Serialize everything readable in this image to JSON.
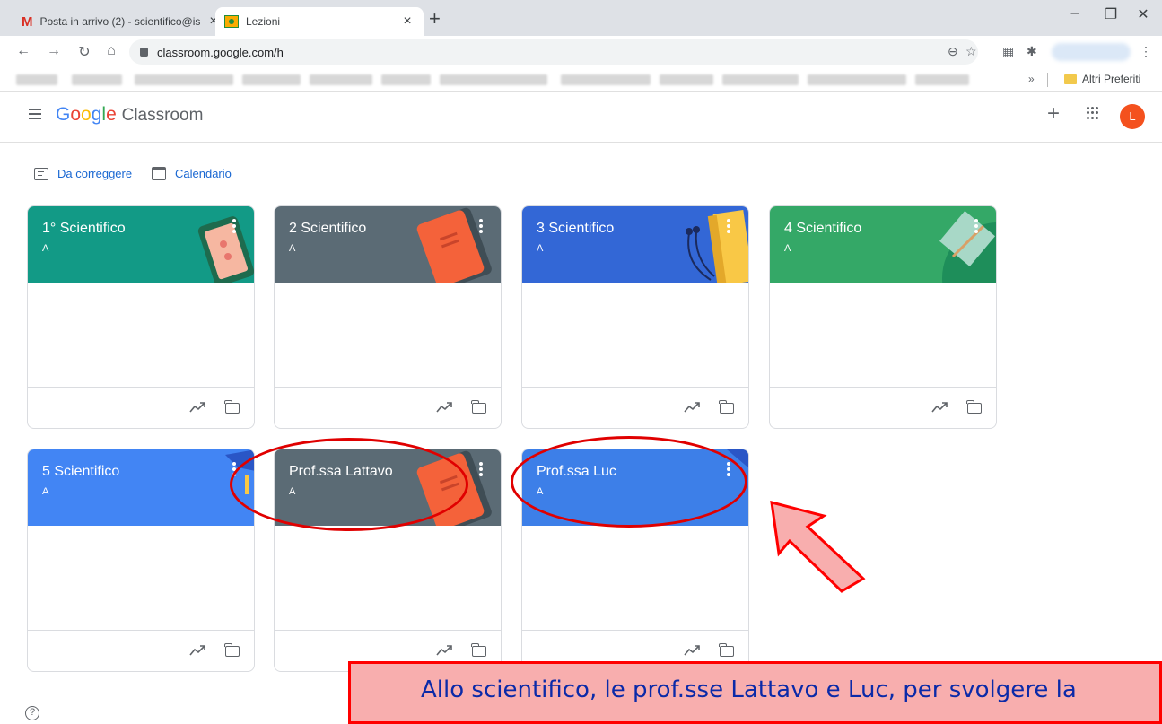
{
  "browser": {
    "tabs": [
      {
        "title": "Posta in arrivo (2) - scientifico@is",
        "icon": "gmail-icon"
      },
      {
        "title": "Lezioni",
        "icon": "classroom-icon"
      }
    ],
    "url": "classroom.google.com/h",
    "bookmarks_more": "»",
    "bookmarks_folder": "Altri Preferiti",
    "new_tab": "+",
    "minimize": "–",
    "maximize": "❐",
    "close": "✕"
  },
  "app": {
    "brand_google": [
      "G",
      "o",
      "o",
      "g",
      "l",
      "e"
    ],
    "brand_product": "Classroom",
    "avatar_letter": "L",
    "links": {
      "todo": "Da correggere",
      "calendar": "Calendario"
    }
  },
  "courses": [
    {
      "title": "1° Scientifico",
      "section": "A",
      "color": "#129a86"
    },
    {
      "title": "2 Scientifico",
      "section": "A",
      "color": "#5b6b75"
    },
    {
      "title": "3 Scientifico",
      "section": "A",
      "color": "#3367d6"
    },
    {
      "title": "4 Scientifico",
      "section": "A",
      "color": "#34a867"
    },
    {
      "title": "5 Scientifico",
      "section": "A",
      "color": "#4285f4"
    },
    {
      "title": "Prof.ssa Lattavo",
      "section": "A",
      "color": "#5b6b75"
    },
    {
      "title": "Prof.ssa Luc",
      "section": "A",
      "color": "#3d7fe8"
    }
  ],
  "annotation": {
    "caption": "Allo scientifico, le prof.sse Lattavo e Luc, per svolgere la",
    "ring_color": "#e00000",
    "arrow_fill": "#f8aeae",
    "arrow_stroke": "#ff0000"
  },
  "help_icon": "?"
}
